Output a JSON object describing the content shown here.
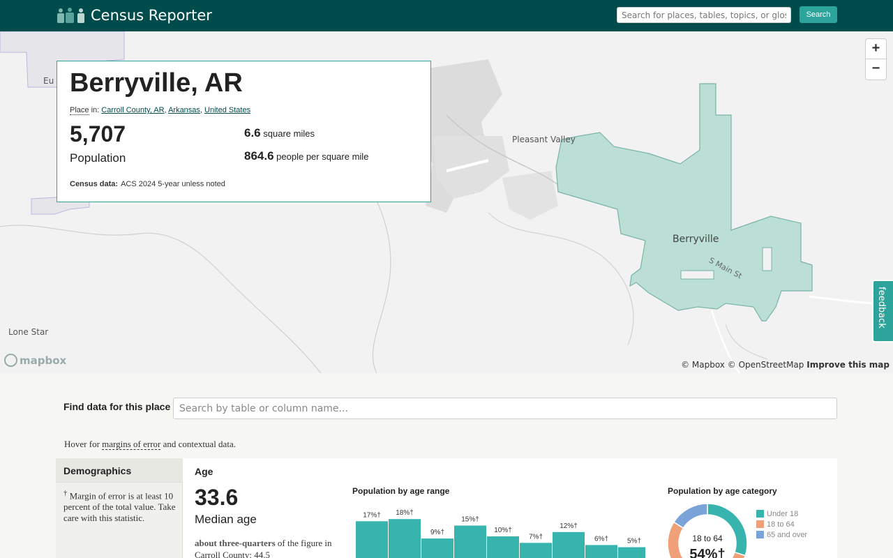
{
  "header": {
    "title": "Census Reporter",
    "search_placeholder": "Search for places, tables, topics, or glossary terms",
    "search_button": "Search"
  },
  "map": {
    "labels": {
      "eu": "Eu",
      "pleasant_valley": "Pleasant Valley",
      "berryville": "Berryville",
      "main_st": "S Main St",
      "lone_star": "Lone Star"
    },
    "zoom_in": "+",
    "zoom_out": "−",
    "mapbox_logo": "mapbox",
    "attribution_mapbox": "© Mapbox",
    "attribution_osm": "© OpenStreetMap",
    "improve": "Improve this map",
    "feedback": "feedback",
    "colors": {
      "boundary_fill": "#b5dcd2",
      "boundary_stroke": "#7ab3a7"
    }
  },
  "place": {
    "name": "Berryville, AR",
    "place_in_label": "Place",
    "in_text": " in: ",
    "parents": [
      "Carroll County, AR",
      "Arkansas",
      "United States"
    ],
    "population": "5,707",
    "population_label": "Population",
    "area_value": "6.6",
    "area_label": "square miles",
    "density_value": "864.6",
    "density_label": "people per square mile",
    "census_label": "Census data:",
    "census_value": "ACS 2024 5-year unless noted"
  },
  "find": {
    "label": "Find data for this place",
    "placeholder": "Search by table or column name..."
  },
  "hover_note": {
    "prefix": "Hover for ",
    "link": "margins of error",
    "suffix": " and contextual data."
  },
  "sidebar": {
    "heading": "Demographics",
    "dagger": "†",
    "moe_note": "Margin of error is at least 10 percent of the total value. Take care with this statistic."
  },
  "age": {
    "section_title": "Age",
    "median": "33.6",
    "median_label": "Median age",
    "compare_bold": "about three-quarters",
    "compare_rest": " of the figure in Carroll County: 44.5"
  },
  "chart_data": [
    {
      "type": "bar",
      "title": "Population by age range",
      "values": [
        17,
        18,
        9,
        15,
        10,
        7,
        12,
        6,
        5
      ],
      "labels": [
        "17%†",
        "18%†",
        "9%†",
        "15%†",
        "10%†",
        "7%†",
        "12%†",
        "6%†",
        "5%†"
      ],
      "color": "#37b4ae"
    },
    {
      "type": "pie",
      "title": "Population by age category",
      "categories": [
        "Under 18",
        "18 to 64",
        "65 and over"
      ],
      "values": [
        30,
        54,
        16
      ],
      "colors": [
        "#37b4ae",
        "#f0a078",
        "#7aa3d8"
      ],
      "center_label": "18 to 64",
      "center_value": "54%†"
    }
  ]
}
